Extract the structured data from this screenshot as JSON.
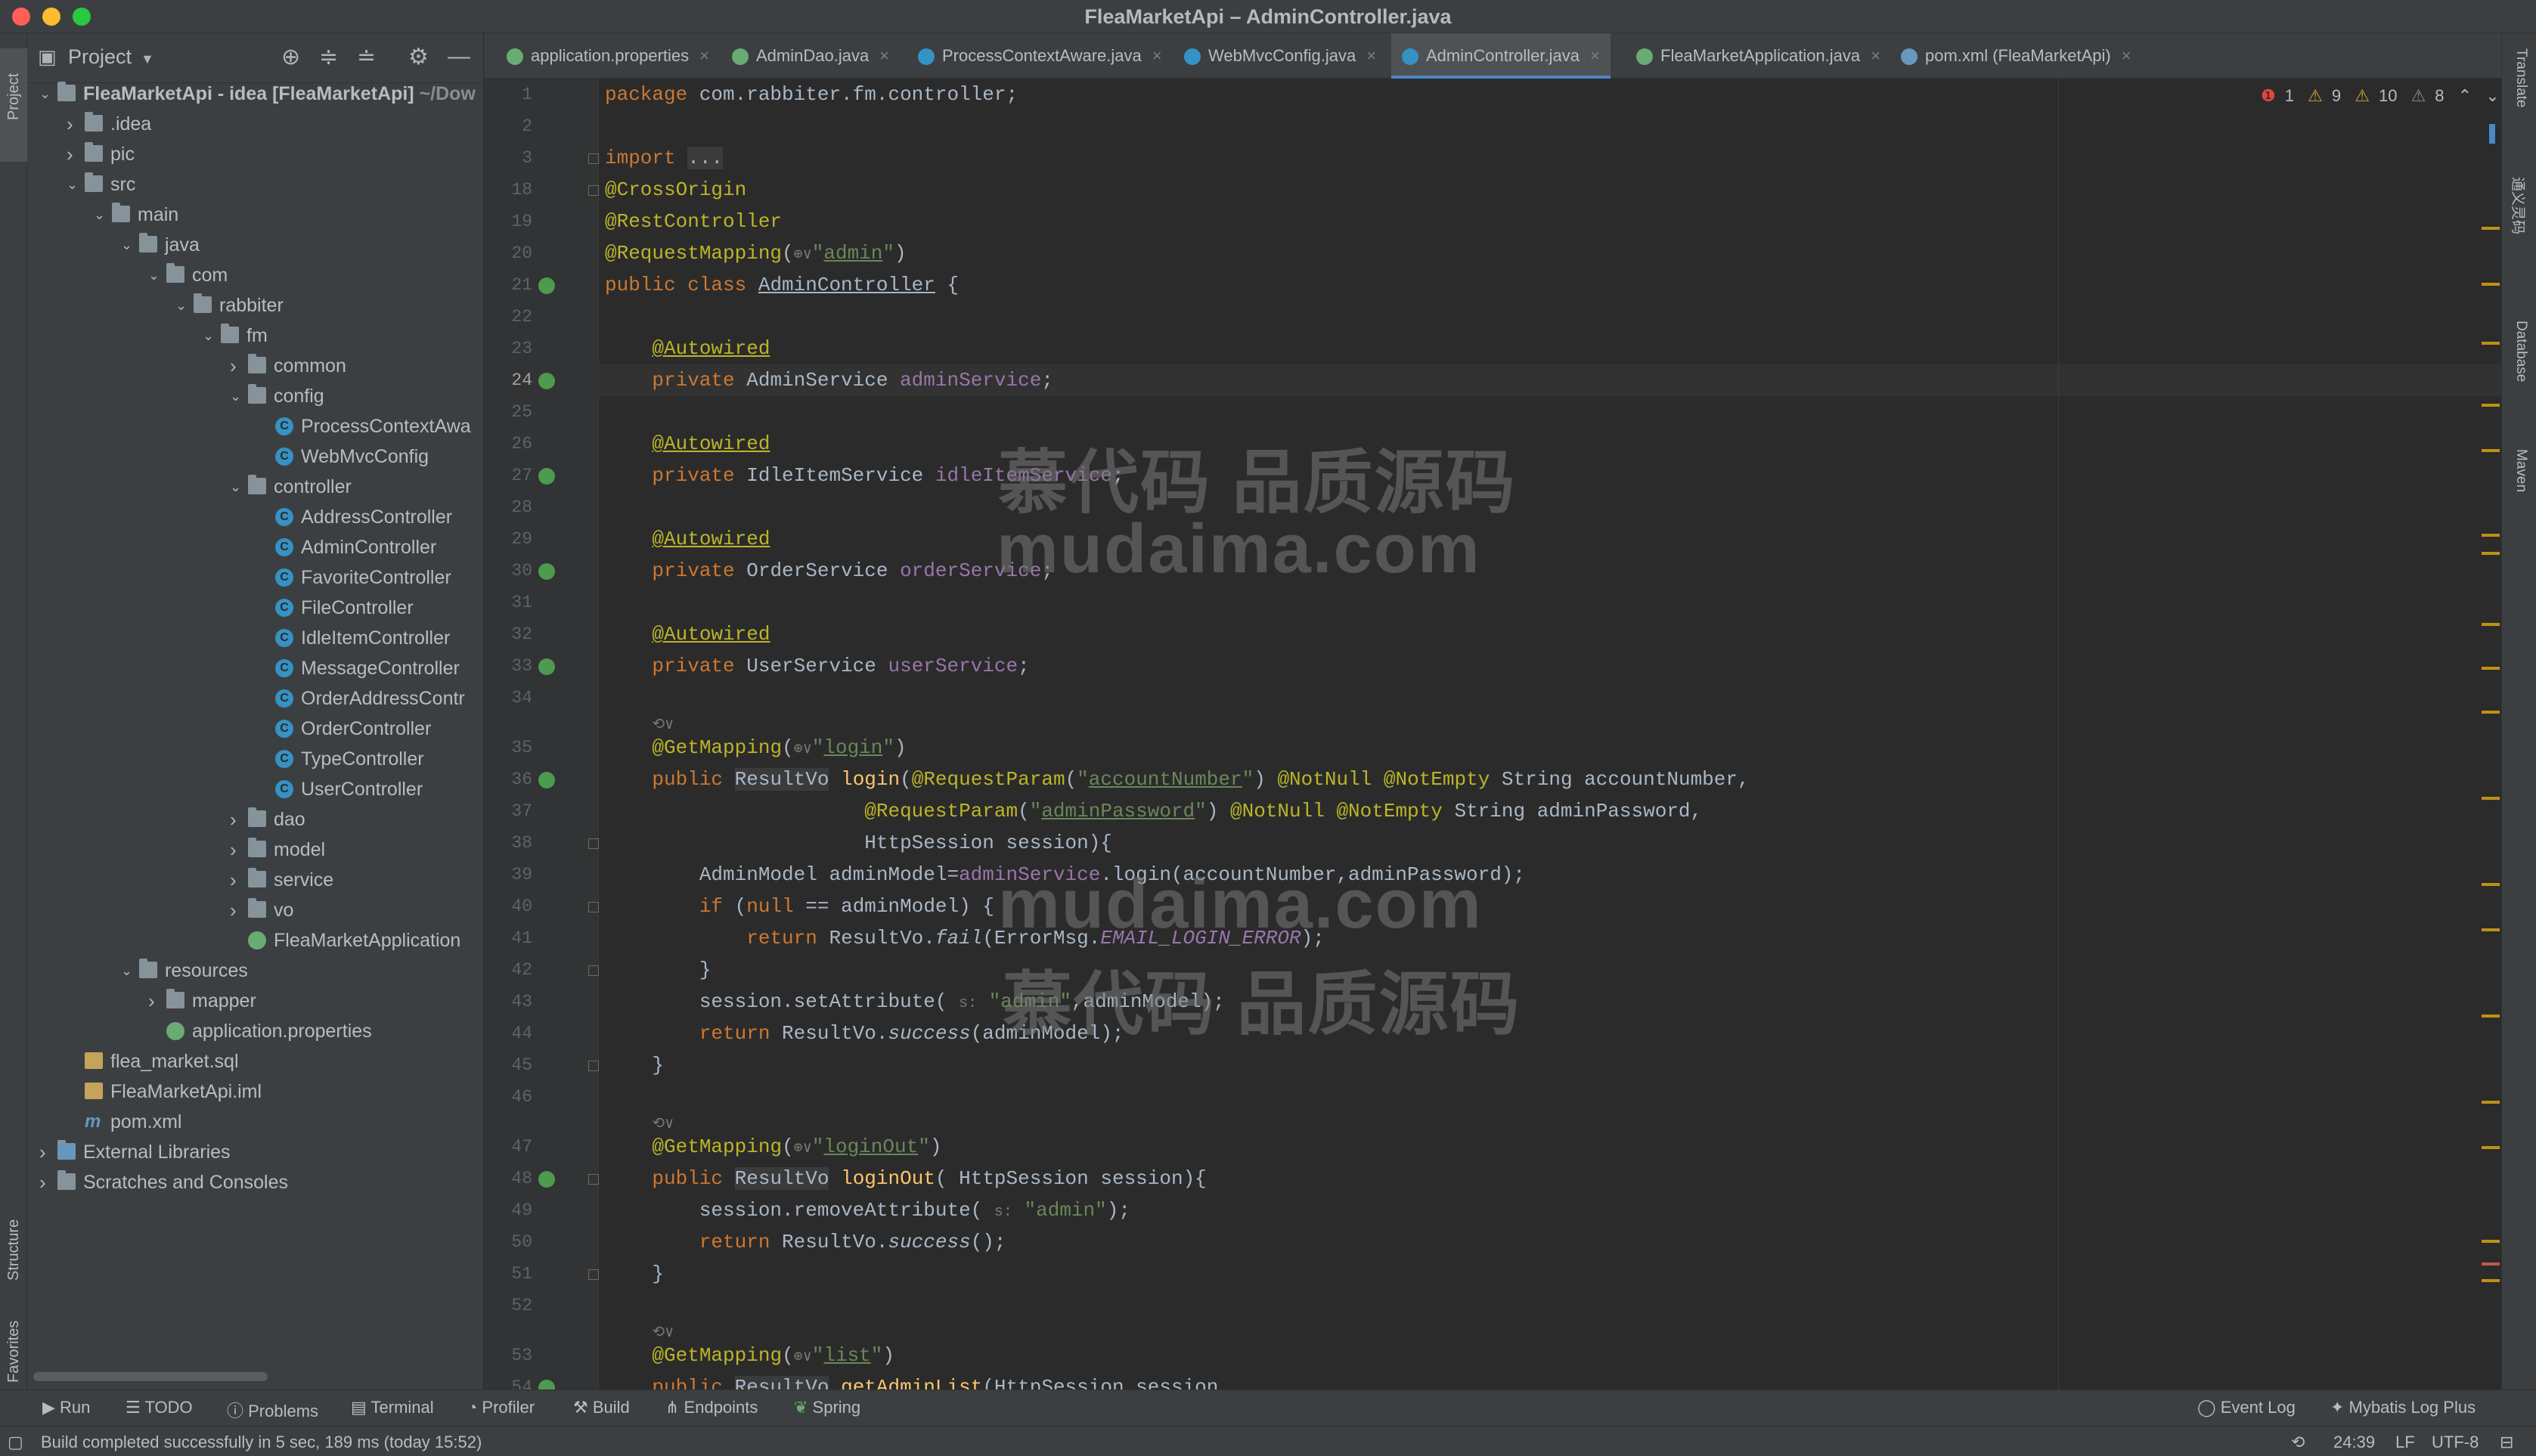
{
  "window": {
    "title": "FleaMarketApi – AdminController.java",
    "traffic_colors": [
      "#ff5f57",
      "#febc2e",
      "#28c840"
    ]
  },
  "left_strip": {
    "project": "Project",
    "structure": "Structure",
    "favorites": "Favorites"
  },
  "project_panel": {
    "title": "Project",
    "tree": [
      {
        "label": "FleaMarketApi - idea [FleaMarketApi]",
        "suffix": " ~/Dow",
        "depth": 0,
        "arrow": "open",
        "icon": "folder",
        "bold": true
      },
      {
        "label": ".idea",
        "depth": 1,
        "arrow": "closed",
        "icon": "folder"
      },
      {
        "label": "pic",
        "depth": 1,
        "arrow": "closed",
        "icon": "folder"
      },
      {
        "label": "src",
        "depth": 1,
        "arrow": "open",
        "icon": "folder"
      },
      {
        "label": "main",
        "depth": 2,
        "arrow": "open",
        "icon": "folder"
      },
      {
        "label": "java",
        "depth": 3,
        "arrow": "open",
        "icon": "folder"
      },
      {
        "label": "com",
        "depth": 4,
        "arrow": "open",
        "icon": "folder"
      },
      {
        "label": "rabbiter",
        "depth": 5,
        "arrow": "open",
        "icon": "folder"
      },
      {
        "label": "fm",
        "depth": 6,
        "arrow": "open",
        "icon": "folder"
      },
      {
        "label": "common",
        "depth": 7,
        "arrow": "closed",
        "icon": "folder"
      },
      {
        "label": "config",
        "depth": 7,
        "arrow": "open",
        "icon": "folder"
      },
      {
        "label": "ProcessContextAwa",
        "depth": 8,
        "arrow": "none",
        "icon": "class"
      },
      {
        "label": "WebMvcConfig",
        "depth": 8,
        "arrow": "none",
        "icon": "class"
      },
      {
        "label": "controller",
        "depth": 7,
        "arrow": "open",
        "icon": "folder"
      },
      {
        "label": "AddressController",
        "depth": 8,
        "arrow": "none",
        "icon": "class"
      },
      {
        "label": "AdminController",
        "depth": 8,
        "arrow": "none",
        "icon": "class"
      },
      {
        "label": "FavoriteController",
        "depth": 8,
        "arrow": "none",
        "icon": "class"
      },
      {
        "label": "FileController",
        "depth": 8,
        "arrow": "none",
        "icon": "class"
      },
      {
        "label": "IdleItemController",
        "depth": 8,
        "arrow": "none",
        "icon": "class"
      },
      {
        "label": "MessageController",
        "depth": 8,
        "arrow": "none",
        "icon": "class"
      },
      {
        "label": "OrderAddressContr",
        "depth": 8,
        "arrow": "none",
        "icon": "class"
      },
      {
        "label": "OrderController",
        "depth": 8,
        "arrow": "none",
        "icon": "class"
      },
      {
        "label": "TypeController",
        "depth": 8,
        "arrow": "none",
        "icon": "class"
      },
      {
        "label": "UserController",
        "depth": 8,
        "arrow": "none",
        "icon": "class"
      },
      {
        "label": "dao",
        "depth": 7,
        "arrow": "closed",
        "icon": "folder"
      },
      {
        "label": "model",
        "depth": 7,
        "arrow": "closed",
        "icon": "folder"
      },
      {
        "label": "service",
        "depth": 7,
        "arrow": "closed",
        "icon": "folder"
      },
      {
        "label": "vo",
        "depth": 7,
        "arrow": "closed",
        "icon": "folder"
      },
      {
        "label": "FleaMarketApplication",
        "depth": 7,
        "arrow": "none",
        "icon": "spring"
      },
      {
        "label": "resources",
        "depth": 3,
        "arrow": "open",
        "icon": "folder"
      },
      {
        "label": "mapper",
        "depth": 4,
        "arrow": "closed",
        "icon": "folder"
      },
      {
        "label": "application.properties",
        "depth": 4,
        "arrow": "none",
        "icon": "spring"
      },
      {
        "label": "flea_market.sql",
        "depth": 1,
        "arrow": "none",
        "icon": "file"
      },
      {
        "label": "FleaMarketApi.iml",
        "depth": 1,
        "arrow": "none",
        "icon": "file"
      },
      {
        "label": "pom.xml",
        "depth": 1,
        "arrow": "none",
        "icon": "maven"
      },
      {
        "label": "External Libraries",
        "depth": 0,
        "arrow": "closed",
        "icon": "library"
      },
      {
        "label": "Scratches and Consoles",
        "depth": 0,
        "arrow": "closed",
        "icon": "scratch"
      }
    ]
  },
  "tabs": [
    {
      "label": "application.properties",
      "icon": "spring"
    },
    {
      "label": "AdminDao.java",
      "icon": "interface"
    },
    {
      "label": "ProcessContextAware.java",
      "icon": "class"
    },
    {
      "label": "WebMvcConfig.java",
      "icon": "class"
    },
    {
      "label": "AdminController.java",
      "icon": "class",
      "active": true
    },
    {
      "label": "FleaMarketApplication.java",
      "icon": "spring"
    },
    {
      "label": "pom.xml (FleaMarketApi)",
      "icon": "maven"
    }
  ],
  "inspections": {
    "errors": "1",
    "warn_a": "9",
    "warn_b": "10",
    "weak": "8"
  },
  "editor": {
    "current_line": "24",
    "lines": [
      {
        "n": "1",
        "html": "<span class='kw'>package</span> com.rabbiter.fm.controller;"
      },
      {
        "n": "2",
        "html": ""
      },
      {
        "n": "3",
        "html": "<span class='kw'>import</span> <span style='background:#3b3b3b'>...</span>",
        "fold": true
      },
      {
        "n": "18",
        "html": "<span class='ann'>@CrossOrigin</span>",
        "fold": true
      },
      {
        "n": "19",
        "html": "<span class='ann'>@RestController</span>"
      },
      {
        "n": "20",
        "html": "<span class='ann'>@RequestMapping</span>(<span class='hint'>⊕∨</span><span class='str'>\"<u>admin</u>\"</span>)"
      },
      {
        "n": "21",
        "html": "<span class='kw'>public class</span> <u>AdminController</u> {",
        "mark": true
      },
      {
        "n": "22",
        "html": ""
      },
      {
        "n": "23",
        "html": "    <span class='ann sq'>@Autowired</span>"
      },
      {
        "n": "24",
        "html": "    <span class='kw'>private</span> AdminService <span class='fld'>adminService</span>;",
        "mark": true
      },
      {
        "n": "25",
        "html": ""
      },
      {
        "n": "26",
        "html": "    <span class='ann sq'>@Autowired</span>"
      },
      {
        "n": "27",
        "html": "    <span class='kw'>private</span> IdleItemService <span class='fld'>idleItemService</span>;",
        "mark": true
      },
      {
        "n": "28",
        "html": ""
      },
      {
        "n": "29",
        "html": "    <span class='ann sq'>@Autowired</span>"
      },
      {
        "n": "30",
        "html": "    <span class='kw'>private</span> OrderService <span class='fld'>orderService</span>;",
        "mark": true
      },
      {
        "n": "31",
        "html": ""
      },
      {
        "n": "32",
        "html": "    <span class='ann sq'>@Autowired</span>"
      },
      {
        "n": "33",
        "html": "    <span class='kw'>private</span> UserService <span class='fld'>userService</span>;",
        "mark": true
      },
      {
        "n": "34",
        "html": ""
      },
      {
        "n": "",
        "html": "    <span class='hint'>⟲∨</span>"
      },
      {
        "n": "35",
        "html": "    <span class='ann'>@GetMapping</span>(<span class='hint'>⊕∨</span><span class='str'>\"<u>login</u>\"</span>)"
      },
      {
        "n": "36",
        "html": "    <span class='kw'>public</span> <span style='background:#3b3b3b'>ResultVo</span> <span style='color:#ffc66d'>login</span>(<span class='ann'>@RequestParam</span>(<span class='str'>\"<u>accountNumber</u>\"</span>) <span class='ann'>@NotNull</span> <span class='ann'>@NotEmpty</span> String accountNumber,",
        "mark": true
      },
      {
        "n": "37",
        "html": "                      <span class='ann'>@RequestParam</span>(<span class='str'>\"<u>adminPassword</u>\"</span>) <span class='ann'>@NotNull</span> <span class='ann'>@NotEmpty</span> String adminPassword,"
      },
      {
        "n": "38",
        "html": "                      HttpSession session){",
        "fold": true
      },
      {
        "n": "39",
        "html": "        AdminModel adminModel=<span class='fld'>adminService</span>.login(accountNumber,adminPassword);"
      },
      {
        "n": "40",
        "html": "        <span class='kw'>if</span> (<span class='kw'>null</span> == adminModel) {",
        "fold": true
      },
      {
        "n": "41",
        "html": "            <span class='kw'>return</span> ResultVo.<span class='ital'>fail</span>(ErrorMsg.<span class='fld ital'>EMAIL_LOGIN_ERROR</span>);"
      },
      {
        "n": "42",
        "html": "        }",
        "fold": true
      },
      {
        "n": "43",
        "html": "        session.setAttribute( <span class='hint'>s:</span> <span class='str'>\"admin\"</span>,adminModel);"
      },
      {
        "n": "44",
        "html": "        <span class='kw'>return</span> ResultVo.<span class='ital'>success</span>(adminModel);"
      },
      {
        "n": "45",
        "html": "    }",
        "fold": true
      },
      {
        "n": "46",
        "html": ""
      },
      {
        "n": "",
        "html": "    <span class='hint'>⟲∨</span>"
      },
      {
        "n": "47",
        "html": "    <span class='ann'>@GetMapping</span>(<span class='hint'>⊕∨</span><span class='str'>\"<u>loginOut</u>\"</span>)"
      },
      {
        "n": "48",
        "html": "    <span class='kw'>public</span> <span style='background:#3b3b3b'>ResultVo</span> <span style='color:#ffc66d'>loginOut</span>( HttpSession session){",
        "mark": true,
        "fold": true
      },
      {
        "n": "49",
        "html": "        session.removeAttribute( <span class='hint'>s:</span> <span class='str'>\"admin\"</span>);"
      },
      {
        "n": "50",
        "html": "        <span class='kw'>return</span> ResultVo.<span class='ital'>success</span>();"
      },
      {
        "n": "51",
        "html": "    }",
        "fold": true
      },
      {
        "n": "52",
        "html": ""
      },
      {
        "n": "",
        "html": "    <span class='hint'>⟲∨</span>"
      },
      {
        "n": "53",
        "html": "    <span class='ann'>@GetMapping</span>(<span class='hint'>⊕∨</span><span class='str'>\"<u>list</u>\"</span>)"
      },
      {
        "n": "54",
        "html": "    <span class='kw'>public</span> <span style='background:#3b3b3b'>ResultVo</span> <span style='color:#ffc66d'>getAdminList</span>(HttpSession session,",
        "mark": true
      }
    ]
  },
  "watermark": {
    "cn": "慕代码 品质源码",
    "en": "mudaima.com"
  },
  "right_strip": {
    "translate": "Translate",
    "mid": "通义灵码",
    "database": "Database",
    "maven": "Maven"
  },
  "bottom_tools": {
    "run": "Run",
    "todo": "TODO",
    "problems": "Problems",
    "terminal": "Terminal",
    "profiler": "Profiler",
    "build": "Build",
    "endpoints": "Endpoints",
    "spring": "Spring",
    "event_log": "Event Log",
    "mybatis": "Mybatis Log Plus"
  },
  "status": {
    "message": "Build completed successfully in 5 sec, 189 ms (today 15:52)",
    "position": "24:39",
    "line_sep": "LF",
    "encoding": "UTF-8"
  }
}
